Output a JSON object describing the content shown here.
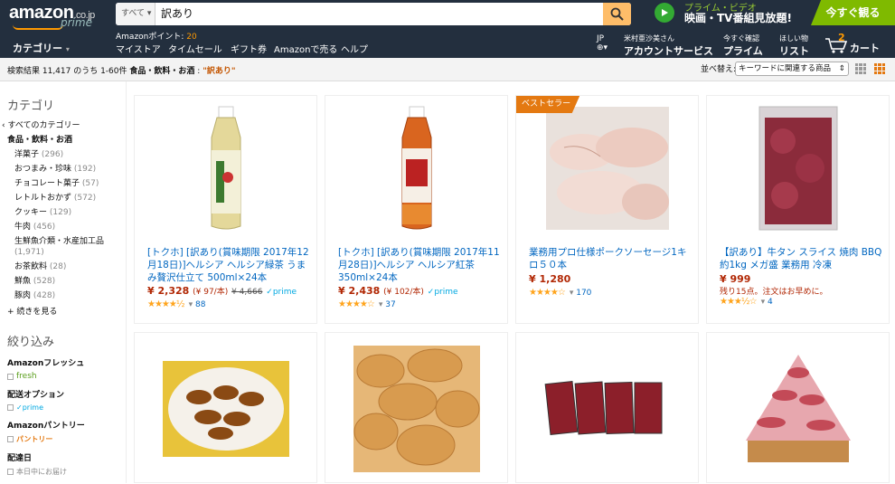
{
  "nav": {
    "logo": {
      "word": "amazon",
      "tld": ".co.jp",
      "sub": "prime"
    },
    "search": {
      "scope": "すべて ▾",
      "query": "訳あり"
    },
    "promo": {
      "line1": "プライム・ビデオ",
      "line2": "映画・TV番組見放題!",
      "button": "今すぐ観る"
    },
    "points": {
      "label": "Amazonポイント:",
      "value": "20"
    },
    "categories": "カテゴリー",
    "links": [
      "マイストア",
      "タイムセール",
      "ギフト券",
      "Amazonで売る",
      "ヘルプ"
    ],
    "lang": "JP",
    "account": {
      "line1": "米村亜沙美さん",
      "line2": "アカウントサービス"
    },
    "prime": {
      "line1": "今すぐ確認",
      "line2": "プライム"
    },
    "wishlist": {
      "line1": "ほしい物",
      "line2": "リスト"
    },
    "cart": {
      "count": "2",
      "label": "カート"
    }
  },
  "toolbar": {
    "results_prefix": "検索結果 11,417 のうち 1-60件",
    "category": "食品・飲料・お酒",
    "sep": ":",
    "query": "\"訳あり\"",
    "sort_label": "並べ替え:",
    "sort_value": "キーワードに関連する商品"
  },
  "sidebar": {
    "heading": "カテゴリ",
    "all": "‹ すべてのカテゴリー",
    "current": "食品・飲料・お酒",
    "items": [
      {
        "name": "洋菓子",
        "count": "(296)"
      },
      {
        "name": "おつまみ・珍味",
        "count": "(192)"
      },
      {
        "name": "チョコレート菓子",
        "count": "(57)"
      },
      {
        "name": "レトルトおかず",
        "count": "(572)"
      },
      {
        "name": "クッキー",
        "count": "(129)"
      },
      {
        "name": "牛肉",
        "count": "(456)"
      },
      {
        "name": "生鮮魚介類・水産加工品",
        "count": "(1,971)"
      },
      {
        "name": "お茶飲料",
        "count": "(28)"
      },
      {
        "name": "鮮魚",
        "count": "(528)"
      },
      {
        "name": "豚肉",
        "count": "(428)"
      }
    ],
    "more": "+ 続きを見る",
    "refine": "絞り込み",
    "fresh_h": "Amazonフレッシュ",
    "fresh": "fresh",
    "ship_h": "配送オプション",
    "prime": "✓prime",
    "pantry_h": "Amazonパントリー",
    "pantry": "パントリー",
    "delivery_h": "配達日",
    "today": "本日中にお届け"
  },
  "products": [
    {
      "title": "[トクホ] [訳あり(賞味期限 2017年12月18日)]ヘルシア ヘルシア緑茶 うまみ贅沢仕立て 500ml×24本",
      "price": "¥ 2,328",
      "unit": "(¥ 97/本)",
      "list": "¥ 4,666",
      "prime": "✓prime",
      "stars": "★★★★½",
      "rating": 4.5,
      "reviews": "88"
    },
    {
      "title": "[トクホ] [訳あり(賞味期限 2017年11月28日)]ヘルシア ヘルシア紅茶 350ml×24本",
      "price": "¥ 2,438",
      "unit": "(¥ 102/本)",
      "list": "",
      "prime": "✓prime",
      "stars": "★★★★☆",
      "rating": 4.0,
      "reviews": "37"
    },
    {
      "badge": "ベストセラー",
      "title": "業務用プロ仕様ポークソーセージ1キロ５０本",
      "price": "¥ 1,280",
      "stars": "★★★★☆",
      "rating": 4.0,
      "reviews": "170"
    },
    {
      "title": "【訳あり】牛タン スライス 焼肉 BBQ 約1kg メガ盛 業務用 冷凍",
      "price": "¥ 999",
      "note": "残り15点。注文はお早めに。",
      "stars": "★★★½☆",
      "rating": 3.5,
      "reviews": "4"
    },
    {
      "title": "",
      "price": ""
    },
    {
      "title": "",
      "price": ""
    },
    {
      "title": "",
      "price": ""
    },
    {
      "title": "",
      "price": ""
    }
  ]
}
